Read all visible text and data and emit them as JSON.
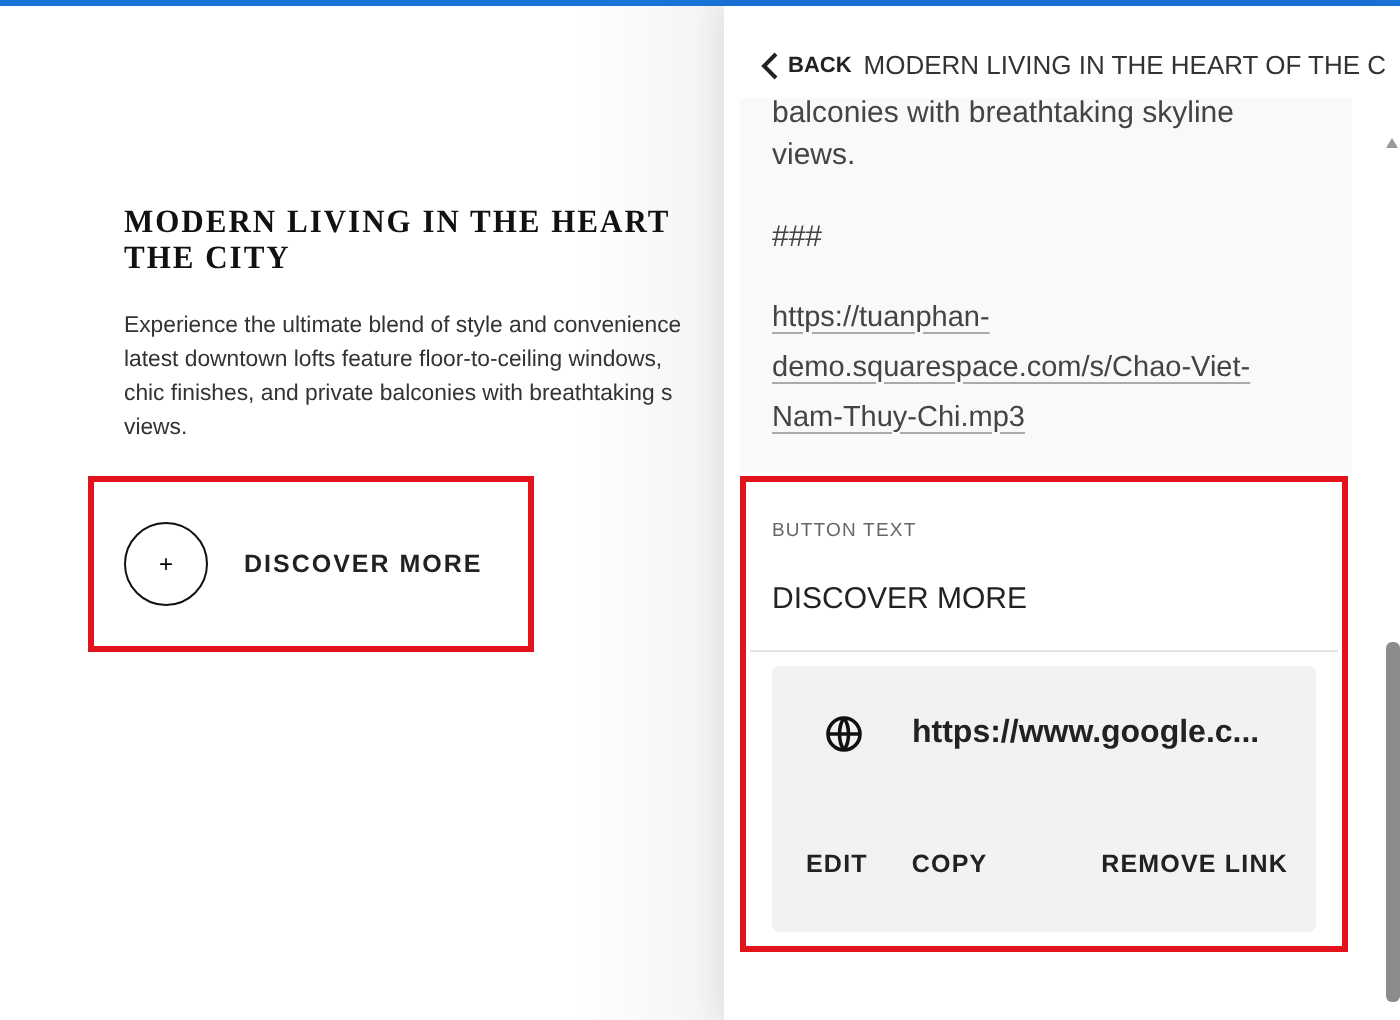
{
  "page": {
    "heading_lines": [
      "MODERN LIVING IN THE HEART",
      "THE CITY"
    ],
    "paragraph_lines": [
      "Experience the ultimate blend of style and convenience",
      "latest downtown lofts feature floor-to-ceiling windows,",
      "chic finishes, and private balconies with breathtaking s",
      "views."
    ],
    "button": {
      "icon": "+",
      "label": "DISCOVER MORE",
      "highlighted": true
    }
  },
  "panel": {
    "back": "BACK",
    "title": "MODERN LIVING IN THE HEART OF THE C",
    "text_lines": [
      "balconies with breathtaking skyline",
      "views."
    ],
    "separator": "###",
    "link": "https://tuanphan-demo.squarespace.com/s/Chao-Viet-Nam-Thuy-Chi.mp3",
    "button_section": {
      "highlighted": true,
      "label": "BUTTON TEXT",
      "value": "DISCOVER MORE",
      "url": "https://www.google.c...",
      "actions": [
        "EDIT",
        "COPY",
        "REMOVE LINK"
      ]
    }
  }
}
